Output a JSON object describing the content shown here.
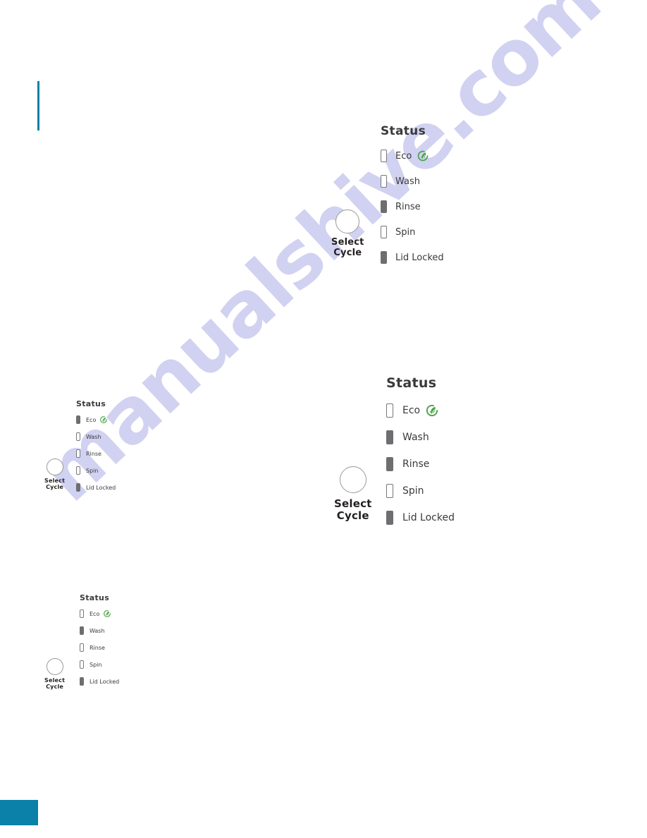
{
  "page": {
    "background_color": "#ffffff",
    "accent_color": "#0b80a8",
    "watermark_text": "manualshive.com",
    "watermark_color": "#c9c9ef"
  },
  "decorations": {
    "top_left_rule_label": "teal-vertical-rule",
    "bottom_left_block_label": "teal-corner-block"
  },
  "icons": {
    "eco_leaf": "eco-leaf-icon",
    "eco_leaf_color": "#4ba34b"
  },
  "knob": {
    "label_line1": "Select",
    "label_line2": "Cycle"
  },
  "panels": [
    {
      "id": "panel-top-right",
      "size": "lg",
      "status_title": "Status",
      "rows": [
        {
          "label": "Eco",
          "state": "off",
          "has_leaf": true
        },
        {
          "label": "Wash",
          "state": "off",
          "has_leaf": false
        },
        {
          "label": "Rinse",
          "state": "on",
          "has_leaf": false
        },
        {
          "label": "Spin",
          "state": "off",
          "has_leaf": false
        },
        {
          "label": "Lid Locked",
          "state": "on",
          "has_leaf": false
        }
      ]
    },
    {
      "id": "panel-small-left-upper",
      "size": "sm",
      "status_title": "Status",
      "rows": [
        {
          "label": "Eco",
          "state": "on",
          "has_leaf": true
        },
        {
          "label": "Wash",
          "state": "off",
          "has_leaf": false
        },
        {
          "label": "Rinse",
          "state": "off",
          "has_leaf": false
        },
        {
          "label": "Spin",
          "state": "off",
          "has_leaf": false
        },
        {
          "label": "Lid Locked",
          "state": "on",
          "has_leaf": false
        }
      ]
    },
    {
      "id": "panel-middle-right",
      "size": "md",
      "status_title": "Status",
      "rows": [
        {
          "label": "Eco",
          "state": "off",
          "has_leaf": true
        },
        {
          "label": "Wash",
          "state": "on",
          "has_leaf": false
        },
        {
          "label": "Rinse",
          "state": "on",
          "has_leaf": false
        },
        {
          "label": "Spin",
          "state": "off",
          "has_leaf": false
        },
        {
          "label": "Lid Locked",
          "state": "on",
          "has_leaf": false
        }
      ]
    },
    {
      "id": "panel-small-left-lower",
      "size": "sm",
      "status_title": "Status",
      "rows": [
        {
          "label": "Eco",
          "state": "off",
          "has_leaf": true
        },
        {
          "label": "Wash",
          "state": "on",
          "has_leaf": false
        },
        {
          "label": "Rinse",
          "state": "off",
          "has_leaf": false
        },
        {
          "label": "Spin",
          "state": "off",
          "has_leaf": false
        },
        {
          "label": "Lid Locked",
          "state": "on",
          "has_leaf": false
        }
      ]
    }
  ]
}
